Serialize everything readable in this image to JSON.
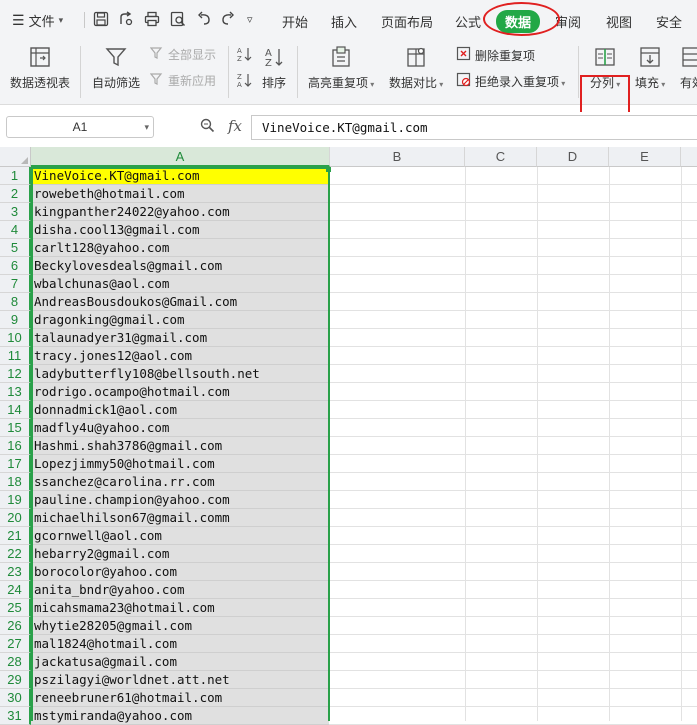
{
  "menubar": {
    "file_label": "文件",
    "tabs": [
      "开始",
      "插入",
      "页面布局",
      "公式",
      "数据",
      "审阅",
      "视图",
      "安全"
    ],
    "active_tab": "数据"
  },
  "ribbon": {
    "pivot": "数据透视表",
    "autofilter": "自动筛选",
    "show_all": "全部显示",
    "reapply": "重新应用",
    "sort": "排序",
    "highlight_dup": "高亮重复项",
    "compare": "数据对比",
    "delete_dup": "删除重复项",
    "reject_dup": "拒绝录入重复项",
    "split_columns": "分列",
    "fill": "填充",
    "valid": "有效"
  },
  "formula_bar": {
    "cell_ref": "A1",
    "fx_label": "fx",
    "content": "VineVoice.KT@gmail.com"
  },
  "grid": {
    "columns": [
      "A",
      "B",
      "C",
      "D",
      "E"
    ],
    "rows": [
      {
        "n": "1",
        "a": "VineVoice.KT@gmail.com"
      },
      {
        "n": "2",
        "a": "rowebeth@hotmail.com"
      },
      {
        "n": "3",
        "a": "kingpanther24022@yahoo.com"
      },
      {
        "n": "4",
        "a": "disha.cool13@gmail.com"
      },
      {
        "n": "5",
        "a": "carlt128@yahoo.com"
      },
      {
        "n": "6",
        "a": "Beckylovesdeals@gmail.com"
      },
      {
        "n": "7",
        "a": "wbalchunas@aol.com"
      },
      {
        "n": "8",
        "a": "AndreasBousdoukos@Gmail.com"
      },
      {
        "n": "9",
        "a": "dragonking@gmail.com"
      },
      {
        "n": "10",
        "a": "talaunadyer31@gmail.com"
      },
      {
        "n": "11",
        "a": "tracy.jones12@aol.com"
      },
      {
        "n": "12",
        "a": "ladybutterfly108@bellsouth.net"
      },
      {
        "n": "13",
        "a": "rodrigo.ocampo@hotmail.com"
      },
      {
        "n": "14",
        "a": "donnadmick1@aol.com"
      },
      {
        "n": "15",
        "a": "madfly4u@yahoo.com"
      },
      {
        "n": "16",
        "a": "Hashmi.shah3786@gmail.com"
      },
      {
        "n": "17",
        "a": "Lopezjimmy50@hotmail.com"
      },
      {
        "n": "18",
        "a": "ssanchez@carolina.rr.com"
      },
      {
        "n": "19",
        "a": "pauline.champion@yahoo.com"
      },
      {
        "n": "20",
        "a": "michaelhilson67@gmail.comm"
      },
      {
        "n": "21",
        "a": "gcornwell@aol.com"
      },
      {
        "n": "22",
        "a": "hebarry2@gmail.com"
      },
      {
        "n": "23",
        "a": "borocolor@yahoo.com"
      },
      {
        "n": "24",
        "a": "anita_bndr@yahoo.com"
      },
      {
        "n": "25",
        "a": "micahsmama23@hotmail.com"
      },
      {
        "n": "26",
        "a": "whytie28205@gmail.com"
      },
      {
        "n": "27",
        "a": "mal1824@hotmail.com"
      },
      {
        "n": "28",
        "a": "jackatusa@gmail.com"
      },
      {
        "n": "29",
        "a": "pszilagyi@worldnet.att.net"
      },
      {
        "n": "30",
        "a": "reneebruner61@hotmail.com"
      },
      {
        "n": "31",
        "a": "mstymiranda@yahoo.com"
      }
    ]
  },
  "colors": {
    "accent_green": "#2aa14a",
    "highlight_yellow": "#ffff00",
    "annotation_red": "#e02020"
  }
}
